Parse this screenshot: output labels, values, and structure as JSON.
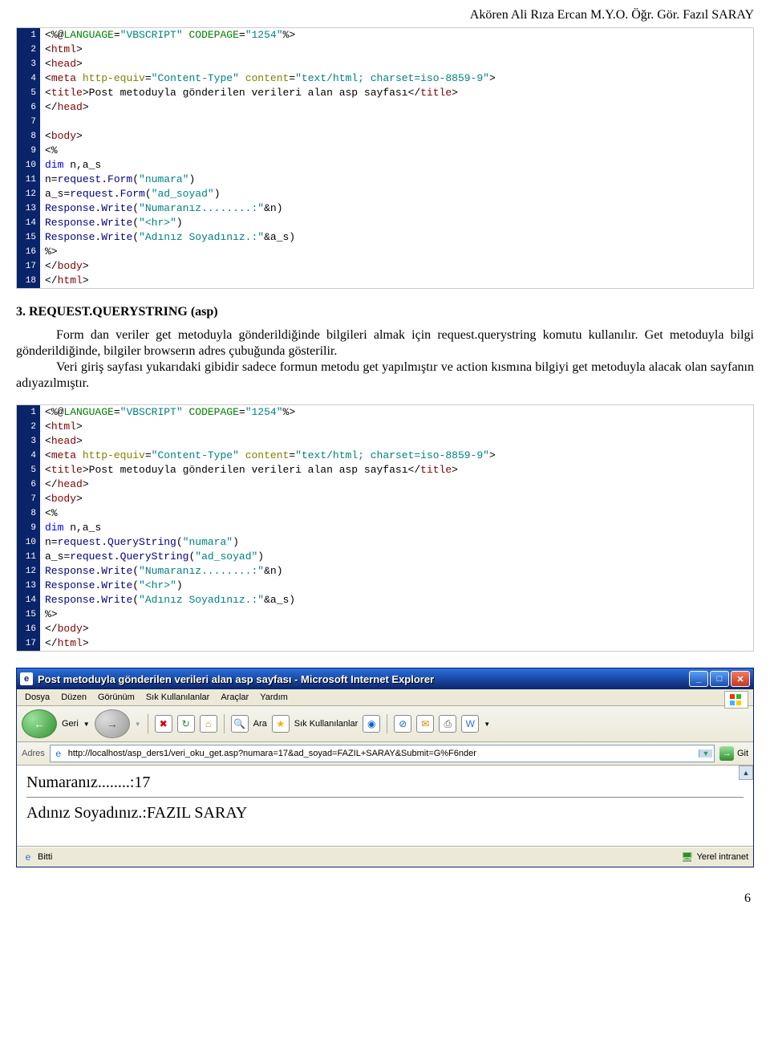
{
  "header": "Akören Ali Rıza Ercan M.Y.O. Öğr. Gör. Fazıl SARAY",
  "code1": {
    "lines": [
      {
        "n": "1",
        "seg": [
          [
            "tok-punct",
            "<%@"
          ],
          [
            "tok-dir",
            "LANGUAGE"
          ],
          [
            "tok-punct",
            "="
          ],
          [
            "tok-str",
            "\"VBSCRIPT\""
          ],
          [
            "tok-punct",
            " "
          ],
          [
            "tok-dir",
            "CODEPAGE"
          ],
          [
            "tok-punct",
            "="
          ],
          [
            "tok-str",
            "\"1254\""
          ],
          [
            "tok-punct",
            "%>"
          ]
        ]
      },
      {
        "n": "2",
        "seg": [
          [
            "tok-punct",
            "<"
          ],
          [
            "tok-tag",
            "html"
          ],
          [
            "tok-punct",
            ">"
          ]
        ]
      },
      {
        "n": "3",
        "seg": [
          [
            "tok-punct",
            "<"
          ],
          [
            "tok-tag",
            "head"
          ],
          [
            "tok-punct",
            ">"
          ]
        ]
      },
      {
        "n": "4",
        "seg": [
          [
            "tok-punct",
            "<"
          ],
          [
            "tok-tag",
            "meta"
          ],
          [
            "tok-punct",
            " "
          ],
          [
            "tok-attr",
            "http-equiv"
          ],
          [
            "tok-punct",
            "="
          ],
          [
            "tok-str",
            "\"Content-Type\""
          ],
          [
            "tok-punct",
            " "
          ],
          [
            "tok-attr",
            "content"
          ],
          [
            "tok-punct",
            "="
          ],
          [
            "tok-str",
            "\"text/html; charset=iso-8859-9\""
          ],
          [
            "tok-punct",
            ">"
          ]
        ]
      },
      {
        "n": "5",
        "seg": [
          [
            "tok-punct",
            "<"
          ],
          [
            "tok-tag",
            "title"
          ],
          [
            "tok-punct",
            ">"
          ],
          [
            "tok-txt",
            "Post metoduyla gönderilen verileri alan asp sayfası"
          ],
          [
            "tok-punct",
            "</"
          ],
          [
            "tok-tag",
            "title"
          ],
          [
            "tok-punct",
            ">"
          ]
        ]
      },
      {
        "n": "6",
        "seg": [
          [
            "tok-punct",
            "</"
          ],
          [
            "tok-tag",
            "head"
          ],
          [
            "tok-punct",
            ">"
          ]
        ]
      },
      {
        "n": "7",
        "seg": []
      },
      {
        "n": "8",
        "seg": [
          [
            "tok-punct",
            "<"
          ],
          [
            "tok-tag",
            "body"
          ],
          [
            "tok-punct",
            ">"
          ]
        ]
      },
      {
        "n": "9",
        "seg": [
          [
            "tok-punct",
            "<%"
          ]
        ]
      },
      {
        "n": "10",
        "seg": [
          [
            "tok-kw",
            "dim"
          ],
          [
            "tok-txt",
            " n,a_s"
          ]
        ]
      },
      {
        "n": "11",
        "seg": [
          [
            "tok-txt",
            "n="
          ],
          [
            "tok-obj",
            "request"
          ],
          [
            "tok-txt",
            "."
          ],
          [
            "tok-obj",
            "Form"
          ],
          [
            "tok-txt",
            "("
          ],
          [
            "tok-str",
            "\"numara\""
          ],
          [
            "tok-txt",
            ")"
          ]
        ]
      },
      {
        "n": "12",
        "seg": [
          [
            "tok-txt",
            "a_s="
          ],
          [
            "tok-obj",
            "request"
          ],
          [
            "tok-txt",
            "."
          ],
          [
            "tok-obj",
            "Form"
          ],
          [
            "tok-txt",
            "("
          ],
          [
            "tok-str",
            "\"ad_soyad\""
          ],
          [
            "tok-txt",
            ")"
          ]
        ]
      },
      {
        "n": "13",
        "seg": [
          [
            "tok-obj",
            "Response"
          ],
          [
            "tok-txt",
            "."
          ],
          [
            "tok-obj",
            "Write"
          ],
          [
            "tok-txt",
            "("
          ],
          [
            "tok-str",
            "\"Numaranız........:\""
          ],
          [
            "tok-txt",
            "&n)"
          ]
        ]
      },
      {
        "n": "14",
        "seg": [
          [
            "tok-obj",
            "Response"
          ],
          [
            "tok-txt",
            "."
          ],
          [
            "tok-obj",
            "Write"
          ],
          [
            "tok-txt",
            "("
          ],
          [
            "tok-str",
            "\"<hr>\""
          ],
          [
            "tok-txt",
            ")"
          ]
        ]
      },
      {
        "n": "15",
        "seg": [
          [
            "tok-obj",
            "Response"
          ],
          [
            "tok-txt",
            "."
          ],
          [
            "tok-obj",
            "Write"
          ],
          [
            "tok-txt",
            "("
          ],
          [
            "tok-str",
            "\"Adınız Soyadınız.:\""
          ],
          [
            "tok-txt",
            "&a_s)"
          ]
        ]
      },
      {
        "n": "16",
        "seg": [
          [
            "tok-punct",
            "%>"
          ]
        ]
      },
      {
        "n": "17",
        "seg": [
          [
            "tok-punct",
            "</"
          ],
          [
            "tok-tag",
            "body"
          ],
          [
            "tok-punct",
            ">"
          ]
        ]
      },
      {
        "n": "18",
        "seg": [
          [
            "tok-punct",
            "</"
          ],
          [
            "tok-tag",
            "html"
          ],
          [
            "tok-punct",
            ">"
          ]
        ]
      }
    ]
  },
  "section_title": "3. REQUEST.QUERYSTRING (asp)",
  "paragraph": "Form dan veriler get metoduyla gönderildiğinde bilgileri almak için request.querystring komutu kullanılır. Get metoduyla bilgi gönderildiğinde, bilgiler browserın adres çubuğunda gösterilir.",
  "paragraph2": "Veri giriş sayfası yukarıdaki gibidir sadece formun metodu get yapılmıştır ve action kısmına bilgiyi get metoduyla alacak olan sayfanın adıyazılmıştır.",
  "code2": {
    "lines": [
      {
        "n": "1",
        "seg": [
          [
            "tok-punct",
            "<%@"
          ],
          [
            "tok-dir",
            "LANGUAGE"
          ],
          [
            "tok-punct",
            "="
          ],
          [
            "tok-str",
            "\"VBSCRIPT\""
          ],
          [
            "tok-punct",
            " "
          ],
          [
            "tok-dir",
            "CODEPAGE"
          ],
          [
            "tok-punct",
            "="
          ],
          [
            "tok-str",
            "\"1254\""
          ],
          [
            "tok-punct",
            "%>"
          ]
        ]
      },
      {
        "n": "2",
        "seg": [
          [
            "tok-punct",
            "<"
          ],
          [
            "tok-tag",
            "html"
          ],
          [
            "tok-punct",
            ">"
          ]
        ]
      },
      {
        "n": "3",
        "seg": [
          [
            "tok-punct",
            "<"
          ],
          [
            "tok-tag",
            "head"
          ],
          [
            "tok-punct",
            ">"
          ]
        ]
      },
      {
        "n": "4",
        "seg": [
          [
            "tok-punct",
            "<"
          ],
          [
            "tok-tag",
            "meta"
          ],
          [
            "tok-punct",
            " "
          ],
          [
            "tok-attr",
            "http-equiv"
          ],
          [
            "tok-punct",
            "="
          ],
          [
            "tok-str",
            "\"Content-Type\""
          ],
          [
            "tok-punct",
            " "
          ],
          [
            "tok-attr",
            "content"
          ],
          [
            "tok-punct",
            "="
          ],
          [
            "tok-str",
            "\"text/html; charset=iso-8859-9\""
          ],
          [
            "tok-punct",
            ">"
          ]
        ]
      },
      {
        "n": "5",
        "seg": [
          [
            "tok-punct",
            "<"
          ],
          [
            "tok-tag",
            "title"
          ],
          [
            "tok-punct",
            ">"
          ],
          [
            "tok-txt",
            "Post metoduyla gönderilen verileri alan asp sayfası"
          ],
          [
            "tok-punct",
            "</"
          ],
          [
            "tok-tag",
            "title"
          ],
          [
            "tok-punct",
            ">"
          ]
        ]
      },
      {
        "n": "6",
        "seg": [
          [
            "tok-punct",
            "</"
          ],
          [
            "tok-tag",
            "head"
          ],
          [
            "tok-punct",
            ">"
          ]
        ]
      },
      {
        "n": "7",
        "seg": [
          [
            "tok-punct",
            "<"
          ],
          [
            "tok-tag",
            "body"
          ],
          [
            "tok-punct",
            ">"
          ]
        ]
      },
      {
        "n": "8",
        "seg": [
          [
            "tok-punct",
            "<%"
          ]
        ]
      },
      {
        "n": "9",
        "seg": [
          [
            "tok-kw",
            "dim"
          ],
          [
            "tok-txt",
            " n,a_s"
          ]
        ]
      },
      {
        "n": "10",
        "seg": [
          [
            "tok-txt",
            "n="
          ],
          [
            "tok-obj",
            "request"
          ],
          [
            "tok-txt",
            "."
          ],
          [
            "tok-obj",
            "QueryString"
          ],
          [
            "tok-txt",
            "("
          ],
          [
            "tok-str",
            "\"numara\""
          ],
          [
            "tok-txt",
            ")"
          ]
        ]
      },
      {
        "n": "11",
        "seg": [
          [
            "tok-txt",
            "a_s="
          ],
          [
            "tok-obj",
            "request"
          ],
          [
            "tok-txt",
            "."
          ],
          [
            "tok-obj",
            "QueryString"
          ],
          [
            "tok-txt",
            "("
          ],
          [
            "tok-str",
            "\"ad_soyad\""
          ],
          [
            "tok-txt",
            ")"
          ]
        ]
      },
      {
        "n": "12",
        "seg": [
          [
            "tok-obj",
            "Response"
          ],
          [
            "tok-txt",
            "."
          ],
          [
            "tok-obj",
            "Write"
          ],
          [
            "tok-txt",
            "("
          ],
          [
            "tok-str",
            "\"Numaranız........:\""
          ],
          [
            "tok-txt",
            "&n)"
          ]
        ]
      },
      {
        "n": "13",
        "seg": [
          [
            "tok-obj",
            "Response"
          ],
          [
            "tok-txt",
            "."
          ],
          [
            "tok-obj",
            "Write"
          ],
          [
            "tok-txt",
            "("
          ],
          [
            "tok-str",
            "\"<hr>\""
          ],
          [
            "tok-txt",
            ")"
          ]
        ]
      },
      {
        "n": "14",
        "seg": [
          [
            "tok-obj",
            "Response"
          ],
          [
            "tok-txt",
            "."
          ],
          [
            "tok-obj",
            "Write"
          ],
          [
            "tok-txt",
            "("
          ],
          [
            "tok-str",
            "\"Adınız Soyadınız.:\""
          ],
          [
            "tok-txt",
            "&a_s)"
          ]
        ]
      },
      {
        "n": "15",
        "seg": [
          [
            "tok-punct",
            "%>"
          ]
        ]
      },
      {
        "n": "16",
        "seg": [
          [
            "tok-punct",
            "</"
          ],
          [
            "tok-tag",
            "body"
          ],
          [
            "tok-punct",
            ">"
          ]
        ]
      },
      {
        "n": "17",
        "seg": [
          [
            "tok-punct",
            "</"
          ],
          [
            "tok-tag",
            "html"
          ],
          [
            "tok-punct",
            ">"
          ]
        ]
      }
    ]
  },
  "ie": {
    "title": "Post metoduyla gönderilen verileri alan asp sayfası - Microsoft Internet Explorer",
    "menu": [
      "Dosya",
      "Düzen",
      "Görünüm",
      "Sık Kullanılanlar",
      "Araçlar",
      "Yardım"
    ],
    "back": "Geri",
    "search": "Ara",
    "fav": "Sık Kullanılanlar",
    "addr_label": "Adres",
    "url": "http://localhost/asp_ders1/veri_oku_get.asp?numara=17&ad_soyad=FAZIL+SARAY&Submit=G%F6nder",
    "go": "Git",
    "line1": "Numaranız........:17",
    "line2": "Adınız Soyadınız.:FAZIL SARAY",
    "status_done": "Bitti",
    "status_zone": "Yerel intranet"
  },
  "page_number": "6"
}
